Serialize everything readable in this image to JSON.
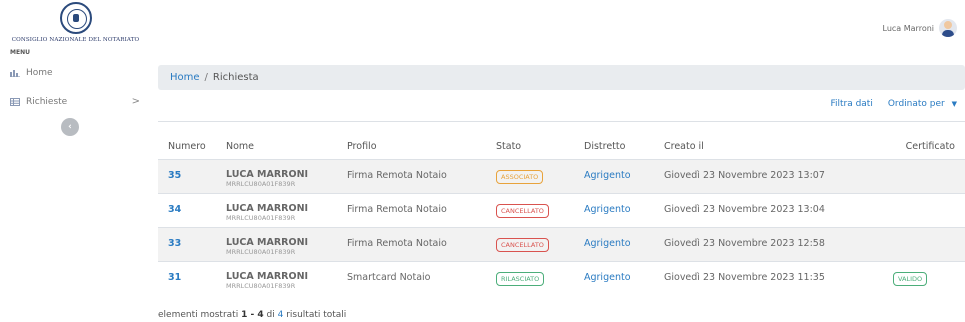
{
  "logo": {
    "line1": "CONSIGLIO NAZIONALE DEL NOTARIATO"
  },
  "sidebar": {
    "menu_label": "MENU",
    "items": [
      {
        "label": "Home",
        "icon": "bar-chart-icon"
      },
      {
        "label": "Richieste",
        "icon": "table-icon",
        "chevron": ">"
      }
    ],
    "collapse_glyph": "‹"
  },
  "user": {
    "name": "Luca Marroni"
  },
  "breadcrumb": {
    "home": "Home",
    "sep": "/",
    "current": "Richiesta"
  },
  "toolbar": {
    "filter": "Filtra dati",
    "sort": "Ordinato per",
    "caret": "▼"
  },
  "table": {
    "headers": [
      "Numero",
      "Nome",
      "Profilo",
      "Stato",
      "Distretto",
      "Creato il",
      "Certificato"
    ],
    "rows": [
      {
        "numero": "35",
        "nome": "LUCA MARRONI",
        "cf": "MRRLCU80A01F839R",
        "profilo": "Firma Remota Notaio",
        "stato": "ASSOCIATO",
        "distretto": "Agrigento",
        "creato": "Giovedì 23 Novembre 2023 13:07",
        "certificato": ""
      },
      {
        "numero": "34",
        "nome": "LUCA MARRONI",
        "cf": "MRRLCU80A01F839R",
        "profilo": "Firma Remota Notaio",
        "stato": "CANCELLATO",
        "distretto": "Agrigento",
        "creato": "Giovedì 23 Novembre 2023 13:04",
        "certificato": ""
      },
      {
        "numero": "33",
        "nome": "LUCA MARRONI",
        "cf": "MRRLCU80A01F839R",
        "profilo": "Firma Remota Notaio",
        "stato": "CANCELLATO",
        "distretto": "Agrigento",
        "creato": "Giovedì 23 Novembre 2023 12:58",
        "certificato": ""
      },
      {
        "numero": "31",
        "nome": "LUCA MARRONI",
        "cf": "MRRLCU80A01F839R",
        "profilo": "Smartcard Notaio",
        "stato": "RILASCIATO",
        "distretto": "Agrigento",
        "creato": "Giovedì 23 Novembre 2023 11:35",
        "certificato": "VALIDO"
      }
    ]
  },
  "status_colors": {
    "ASSOCIATO": "#e8a33c",
    "CANCELLATO": "#d9534f",
    "RILASCIATO": "#4cae7a",
    "VALIDO": "#4cae7a"
  },
  "footer": {
    "prefix": "elementi mostrati",
    "range": "1 - 4",
    "mid": "di",
    "total": "4",
    "suffix": "risultati totali"
  }
}
